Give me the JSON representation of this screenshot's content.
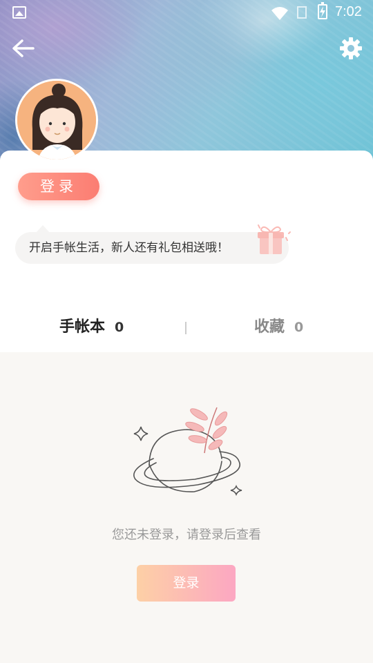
{
  "status_bar": {
    "time": "7:02",
    "icons": [
      "image-icon",
      "wifi-icon",
      "no-signal-icon",
      "battery-charging-icon"
    ]
  },
  "header": {
    "back_icon": "arrow-left-icon",
    "settings_icon": "gear-icon",
    "avatar": "girl-avatar-illustration"
  },
  "profile": {
    "login_label": "登录",
    "tip_text": "开启手帐生活，新人还有礼包相送哦！",
    "tip_icon": "gift-icon"
  },
  "tabs": [
    {
      "label": "手帐本",
      "count": "0",
      "active": true
    },
    {
      "label": "收藏",
      "count": "0",
      "active": false
    }
  ],
  "empty_state": {
    "illustration": "planet-with-leaf-illustration",
    "message": "您还未登录，请登录后查看",
    "button_label": "登录"
  },
  "colors": {
    "login_pill": "#fb7d72",
    "button_gradient_start": "#fdd0a6",
    "button_gradient_end": "#fca7c2",
    "page_bg": "#f9f7f4"
  }
}
